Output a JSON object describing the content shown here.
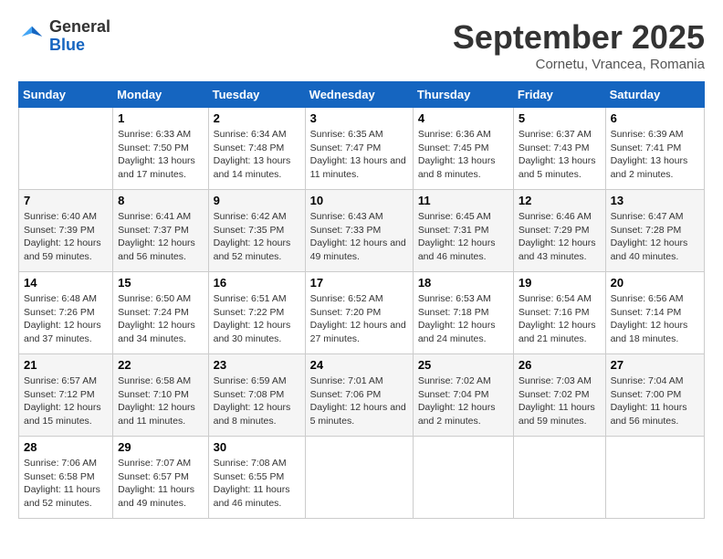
{
  "logo": {
    "general": "General",
    "blue": "Blue"
  },
  "title": "September 2025",
  "location": "Cornetu, Vrancea, Romania",
  "weekdays": [
    "Sunday",
    "Monday",
    "Tuesday",
    "Wednesday",
    "Thursday",
    "Friday",
    "Saturday"
  ],
  "weeks": [
    [
      {
        "day": "",
        "sunrise": "",
        "sunset": "",
        "daylight": ""
      },
      {
        "day": "1",
        "sunrise": "Sunrise: 6:33 AM",
        "sunset": "Sunset: 7:50 PM",
        "daylight": "Daylight: 13 hours and 17 minutes."
      },
      {
        "day": "2",
        "sunrise": "Sunrise: 6:34 AM",
        "sunset": "Sunset: 7:48 PM",
        "daylight": "Daylight: 13 hours and 14 minutes."
      },
      {
        "day": "3",
        "sunrise": "Sunrise: 6:35 AM",
        "sunset": "Sunset: 7:47 PM",
        "daylight": "Daylight: 13 hours and 11 minutes."
      },
      {
        "day": "4",
        "sunrise": "Sunrise: 6:36 AM",
        "sunset": "Sunset: 7:45 PM",
        "daylight": "Daylight: 13 hours and 8 minutes."
      },
      {
        "day": "5",
        "sunrise": "Sunrise: 6:37 AM",
        "sunset": "Sunset: 7:43 PM",
        "daylight": "Daylight: 13 hours and 5 minutes."
      },
      {
        "day": "6",
        "sunrise": "Sunrise: 6:39 AM",
        "sunset": "Sunset: 7:41 PM",
        "daylight": "Daylight: 13 hours and 2 minutes."
      }
    ],
    [
      {
        "day": "7",
        "sunrise": "Sunrise: 6:40 AM",
        "sunset": "Sunset: 7:39 PM",
        "daylight": "Daylight: 12 hours and 59 minutes."
      },
      {
        "day": "8",
        "sunrise": "Sunrise: 6:41 AM",
        "sunset": "Sunset: 7:37 PM",
        "daylight": "Daylight: 12 hours and 56 minutes."
      },
      {
        "day": "9",
        "sunrise": "Sunrise: 6:42 AM",
        "sunset": "Sunset: 7:35 PM",
        "daylight": "Daylight: 12 hours and 52 minutes."
      },
      {
        "day": "10",
        "sunrise": "Sunrise: 6:43 AM",
        "sunset": "Sunset: 7:33 PM",
        "daylight": "Daylight: 12 hours and 49 minutes."
      },
      {
        "day": "11",
        "sunrise": "Sunrise: 6:45 AM",
        "sunset": "Sunset: 7:31 PM",
        "daylight": "Daylight: 12 hours and 46 minutes."
      },
      {
        "day": "12",
        "sunrise": "Sunrise: 6:46 AM",
        "sunset": "Sunset: 7:29 PM",
        "daylight": "Daylight: 12 hours and 43 minutes."
      },
      {
        "day": "13",
        "sunrise": "Sunrise: 6:47 AM",
        "sunset": "Sunset: 7:28 PM",
        "daylight": "Daylight: 12 hours and 40 minutes."
      }
    ],
    [
      {
        "day": "14",
        "sunrise": "Sunrise: 6:48 AM",
        "sunset": "Sunset: 7:26 PM",
        "daylight": "Daylight: 12 hours and 37 minutes."
      },
      {
        "day": "15",
        "sunrise": "Sunrise: 6:50 AM",
        "sunset": "Sunset: 7:24 PM",
        "daylight": "Daylight: 12 hours and 34 minutes."
      },
      {
        "day": "16",
        "sunrise": "Sunrise: 6:51 AM",
        "sunset": "Sunset: 7:22 PM",
        "daylight": "Daylight: 12 hours and 30 minutes."
      },
      {
        "day": "17",
        "sunrise": "Sunrise: 6:52 AM",
        "sunset": "Sunset: 7:20 PM",
        "daylight": "Daylight: 12 hours and 27 minutes."
      },
      {
        "day": "18",
        "sunrise": "Sunrise: 6:53 AM",
        "sunset": "Sunset: 7:18 PM",
        "daylight": "Daylight: 12 hours and 24 minutes."
      },
      {
        "day": "19",
        "sunrise": "Sunrise: 6:54 AM",
        "sunset": "Sunset: 7:16 PM",
        "daylight": "Daylight: 12 hours and 21 minutes."
      },
      {
        "day": "20",
        "sunrise": "Sunrise: 6:56 AM",
        "sunset": "Sunset: 7:14 PM",
        "daylight": "Daylight: 12 hours and 18 minutes."
      }
    ],
    [
      {
        "day": "21",
        "sunrise": "Sunrise: 6:57 AM",
        "sunset": "Sunset: 7:12 PM",
        "daylight": "Daylight: 12 hours and 15 minutes."
      },
      {
        "day": "22",
        "sunrise": "Sunrise: 6:58 AM",
        "sunset": "Sunset: 7:10 PM",
        "daylight": "Daylight: 12 hours and 11 minutes."
      },
      {
        "day": "23",
        "sunrise": "Sunrise: 6:59 AM",
        "sunset": "Sunset: 7:08 PM",
        "daylight": "Daylight: 12 hours and 8 minutes."
      },
      {
        "day": "24",
        "sunrise": "Sunrise: 7:01 AM",
        "sunset": "Sunset: 7:06 PM",
        "daylight": "Daylight: 12 hours and 5 minutes."
      },
      {
        "day": "25",
        "sunrise": "Sunrise: 7:02 AM",
        "sunset": "Sunset: 7:04 PM",
        "daylight": "Daylight: 12 hours and 2 minutes."
      },
      {
        "day": "26",
        "sunrise": "Sunrise: 7:03 AM",
        "sunset": "Sunset: 7:02 PM",
        "daylight": "Daylight: 11 hours and 59 minutes."
      },
      {
        "day": "27",
        "sunrise": "Sunrise: 7:04 AM",
        "sunset": "Sunset: 7:00 PM",
        "daylight": "Daylight: 11 hours and 56 minutes."
      }
    ],
    [
      {
        "day": "28",
        "sunrise": "Sunrise: 7:06 AM",
        "sunset": "Sunset: 6:58 PM",
        "daylight": "Daylight: 11 hours and 52 minutes."
      },
      {
        "day": "29",
        "sunrise": "Sunrise: 7:07 AM",
        "sunset": "Sunset: 6:57 PM",
        "daylight": "Daylight: 11 hours and 49 minutes."
      },
      {
        "day": "30",
        "sunrise": "Sunrise: 7:08 AM",
        "sunset": "Sunset: 6:55 PM",
        "daylight": "Daylight: 11 hours and 46 minutes."
      },
      {
        "day": "",
        "sunrise": "",
        "sunset": "",
        "daylight": ""
      },
      {
        "day": "",
        "sunrise": "",
        "sunset": "",
        "daylight": ""
      },
      {
        "day": "",
        "sunrise": "",
        "sunset": "",
        "daylight": ""
      },
      {
        "day": "",
        "sunrise": "",
        "sunset": "",
        "daylight": ""
      }
    ]
  ]
}
